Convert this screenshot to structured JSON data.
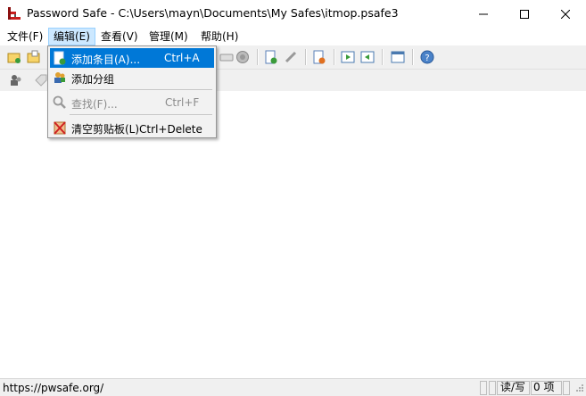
{
  "window": {
    "title": "Password Safe - C:\\Users\\mayn\\Documents\\My Safes\\itmop.psafe3"
  },
  "menubar": {
    "items": [
      {
        "label": "文件(F)"
      },
      {
        "label": "编辑(E)"
      },
      {
        "label": "查看(V)"
      },
      {
        "label": "管理(M)"
      },
      {
        "label": "帮助(H)"
      }
    ]
  },
  "edit_menu": {
    "add_entry": {
      "label": "添加条目(A)...",
      "shortcut": "Ctrl+A"
    },
    "add_group": {
      "label": "添加分组"
    },
    "find": {
      "label": "查找(F)...",
      "shortcut": "Ctrl+F"
    },
    "clear_clipboard": {
      "label": "清空剪贴板(L)Ctrl+Delete"
    }
  },
  "statusbar": {
    "url": "https://pwsafe.org/",
    "mode": "读/写",
    "count": "0 项"
  },
  "colors": {
    "accent": "#0078d7",
    "menu_hover": "#cce8ff"
  }
}
